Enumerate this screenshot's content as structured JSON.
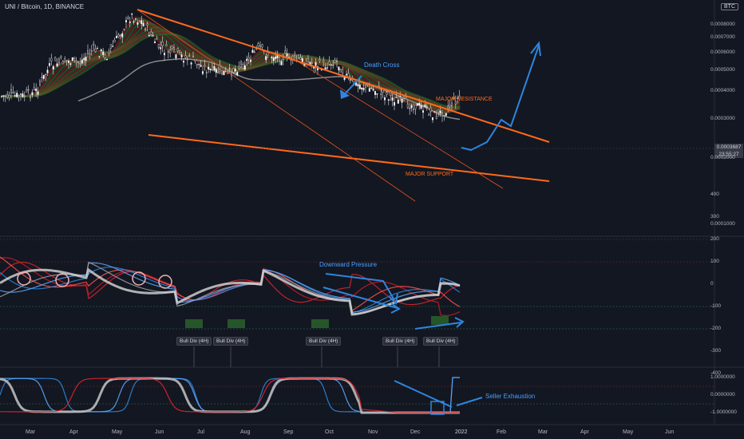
{
  "header": {
    "title": "UNI / Bitcoin, 1D, BINANCE",
    "currency": "BTC"
  },
  "annotations": {
    "death_cross": "Death Cross",
    "major_resistance": "MAJOR RESISTANCE",
    "major_support": "MAJOR SUPPORT",
    "downward_pressure": "Downward Pressure",
    "seller_exhaustion": "Seller Exhaustion",
    "bull_div": [
      "Bull Div (4H)",
      "Bull Div (4H)",
      "Bull Div (4H)",
      "Bull Div (4H)",
      "Bull Div (4H)"
    ]
  },
  "last_price": {
    "value": "0.0003687",
    "countdown": "23:55:27"
  },
  "colors": {
    "background": "#131722",
    "resistance": "#ff6a1a",
    "projection": "#2e86de",
    "bull": "#2e9e3a",
    "bear": "#e0242b",
    "ma": "#8a8a8a"
  },
  "chart_data": [
    {
      "type": "line",
      "title": "UNI / Bitcoin, 1D, BINANCE",
      "x_ticks": [
        "Mar",
        "Apr",
        "May",
        "Jun",
        "Jul",
        "Aug",
        "Sep",
        "Oct",
        "Nov",
        "Dec",
        "2022",
        "Feb",
        "Mar",
        "Apr",
        "May",
        "Jun"
      ],
      "y_ticks": [
        "0.0008000",
        "0.0007000",
        "0.0006000",
        "0.0005000",
        "0.0004000",
        "0.0003000",
        "0.0002000",
        "0.0001000"
      ],
      "y_scale": "log",
      "ylim": [
        8e-05,
        0.0011
      ],
      "series": [
        {
          "x": [
            "2021-02-25",
            "2021-03-05",
            "2021-03-15",
            "2021-03-25",
            "2021-04-05",
            "2021-04-15",
            "2021-04-25",
            "2021-05-05",
            "2021-05-12",
            "2021-05-20",
            "2021-06-01",
            "2021-06-15",
            "2021-06-25",
            "2021-07-05",
            "2021-07-20",
            "2021-08-01",
            "2021-08-10",
            "2021-08-20",
            "2021-09-01",
            "2021-09-10",
            "2021-09-25",
            "2021-10-05",
            "2021-10-15",
            "2021-10-25",
            "2021-11-05",
            "2021-11-15",
            "2021-11-25",
            "2021-12-05",
            "2021-12-15",
            "2021-12-22",
            "2021-12-30"
          ],
          "values": [
            0.00038,
            0.0004,
            0.00052,
            0.00055,
            0.00054,
            0.00062,
            0.00058,
            0.00075,
            0.00088,
            0.00082,
            0.00063,
            0.00058,
            0.00055,
            0.0005,
            0.00048,
            0.00054,
            0.00062,
            0.00058,
            0.00057,
            0.00055,
            0.00052,
            0.00055,
            0.00044,
            0.00042,
            0.0004,
            0.00037,
            0.00035,
            0.00034,
            0.00031,
            0.00033,
            0.00037
          ]
        }
      ]
    },
    {
      "type": "line",
      "y_ticks": [
        "400",
        "300",
        "200",
        "100",
        "0",
        "-100",
        "-200",
        "-300",
        "-400"
      ],
      "ylim": [
        -400,
        400
      ]
    },
    {
      "type": "line",
      "y_ticks": [
        "1.0000000",
        "0.0000000",
        "-1.0000000"
      ],
      "ylim": [
        -1.2,
        1.2
      ]
    }
  ]
}
